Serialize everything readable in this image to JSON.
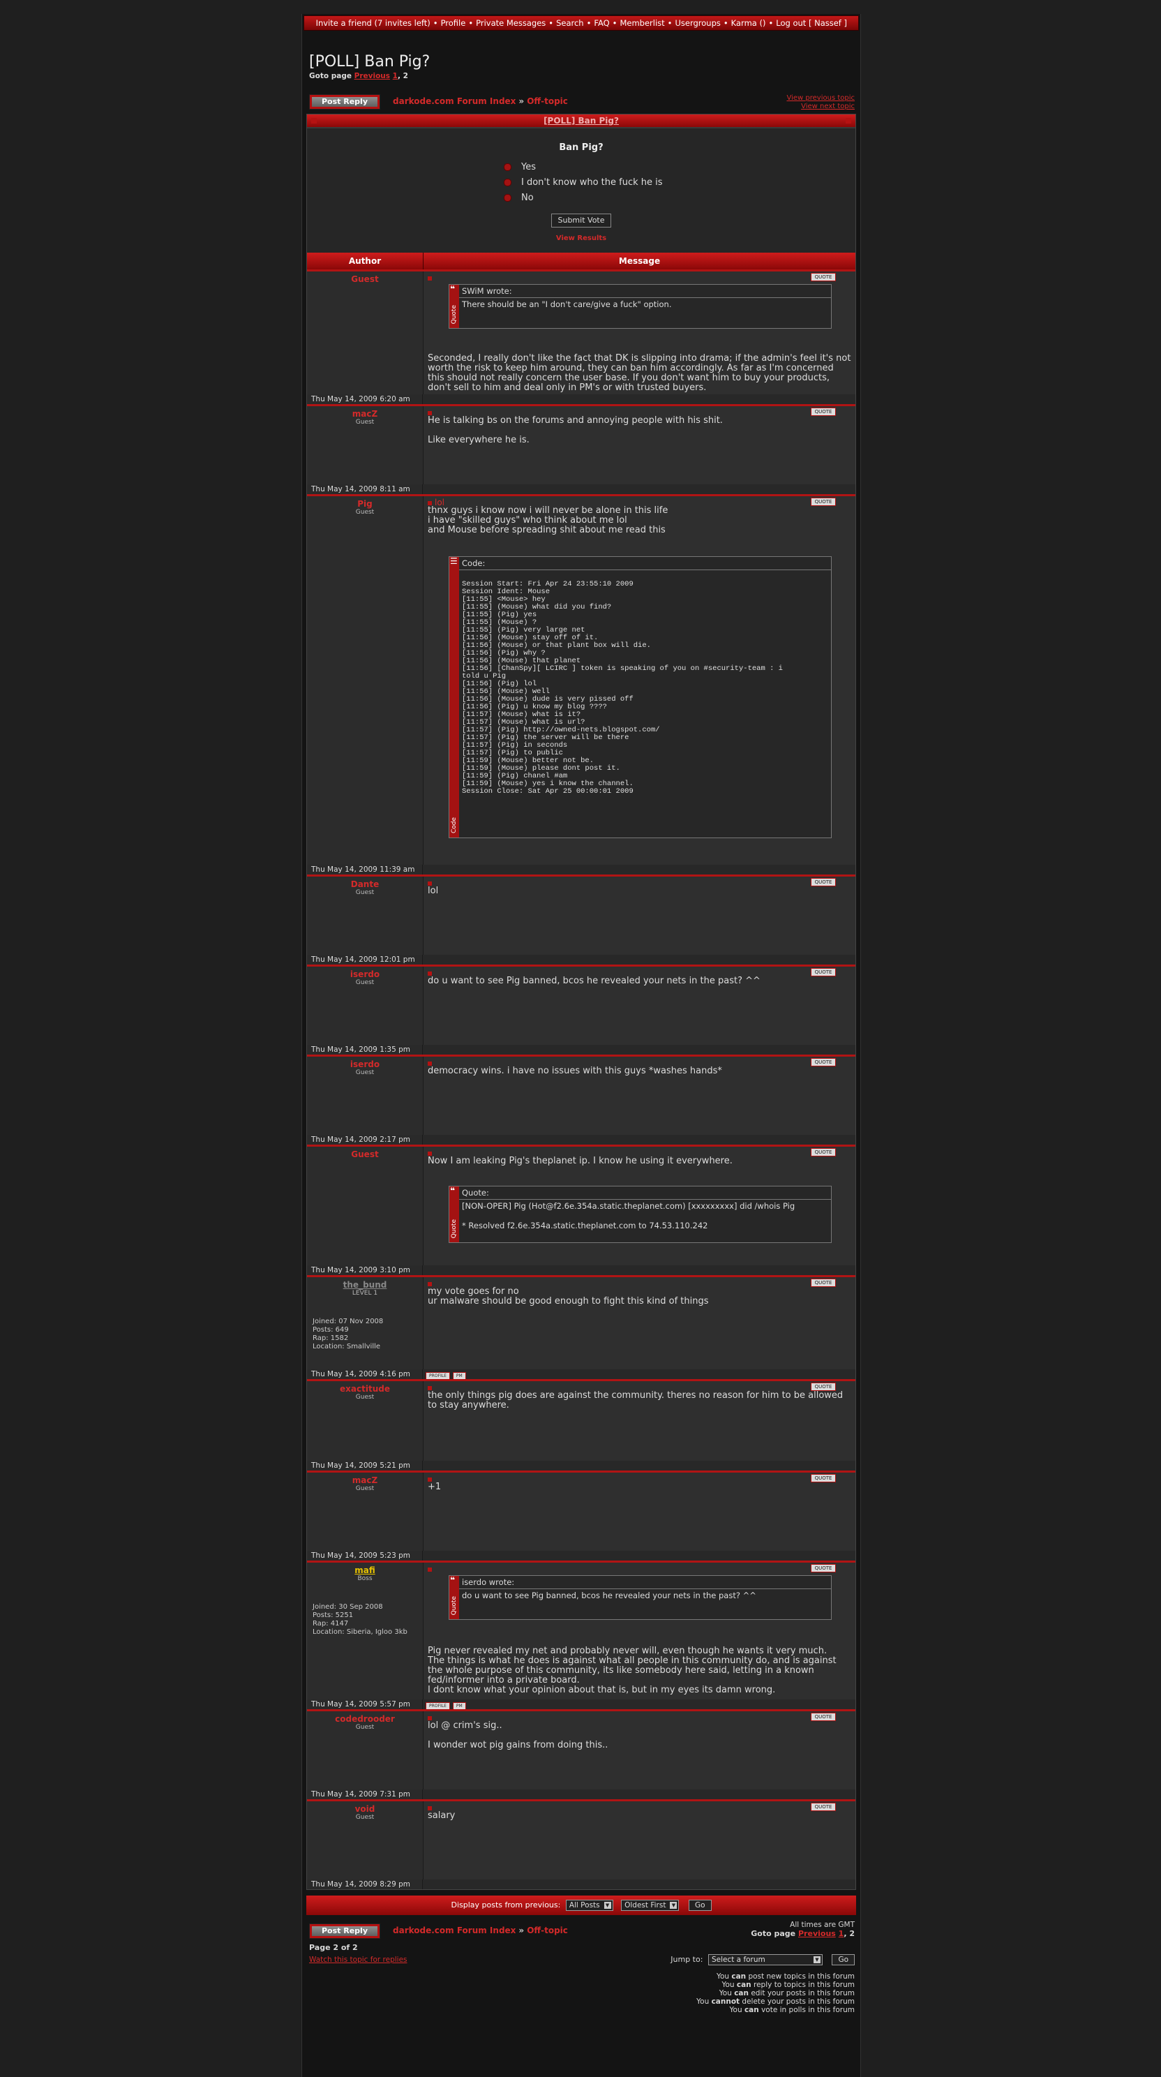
{
  "nav": {
    "items": [
      "Invite a friend (7 invites left)",
      "Profile",
      "Private Messages",
      "Search",
      "FAQ",
      "Memberlist",
      "Usergroups",
      "Karma ()",
      "Log out [ Nassef ]"
    ],
    "sep": "•"
  },
  "topic": {
    "title": "[POLL] Ban Pig?",
    "goto_label": "Goto page",
    "prev_label": "Previous",
    "page_one": "1",
    "page_two": ", 2"
  },
  "crumbs": {
    "reply_label": "Post Reply",
    "index": "darkode.com Forum Index",
    "sep": "»",
    "forum": "Off-topic",
    "view_prev": "View previous topic",
    "view_next": "View next topic"
  },
  "poll": {
    "bar_title": "[POLL] Ban Pig?",
    "question": "Ban Pig?",
    "options": [
      "Yes",
      "I don't know who the fuck he is",
      "No"
    ],
    "submit": "Submit Vote",
    "view_results": "View Results"
  },
  "table_head": {
    "author": "Author",
    "message": "Message"
  },
  "quote_btn": "QUOTE",
  "quote_side": "Quote",
  "code_side": "Code",
  "profile_btn": "PROFILE",
  "pm_btn": "PM",
  "posts": [
    {
      "author": "Guest",
      "rank": "",
      "date": "Thu May 14, 2009 6:20 am",
      "quote_head": "SWiM wrote:",
      "quote_body": "There should be an \"I don't care/give a fuck\" option.",
      "lines": [
        "Seconded, I really don't like the fact that DK is slipping into drama; if the admin's feel it's not worth the risk to keep him around, they can ban him accordingly. As far as I'm concerned this should not really concern the user base. If you don't want him to buy your products, don't sell to him and deal only in PM's or with trusted buyers."
      ]
    },
    {
      "author": "macZ",
      "rank": "Guest",
      "date": "Thu May 14, 2009 8:11 am",
      "lines": [
        "He is talking bs on the forums and annoying people with his shit.",
        "",
        "Like everywhere he is."
      ]
    },
    {
      "author": "Pig",
      "rank": "Guest",
      "date": "Thu May 14, 2009 11:39 am",
      "subject": "lol",
      "lines": [
        "thnx guys i know now i will never be alone in this life",
        "i have \"skilled guys\" who think about me lol",
        "and Mouse before spreading shit about me read this"
      ],
      "code_head": "Code:",
      "code": "\nSession Start: Fri Apr 24 23:55:10 2009\nSession Ident: Mouse\n[11:55] <Mouse> hey\n[11:55] (Mouse) what did you find?\n[11:55] (Pig) yes\n[11:55] (Mouse) ?\n[11:55] (Pig) very large net\n[11:56] (Mouse) stay off of it.\n[11:56] (Mouse) or that plant box will die.\n[11:56] (Pig) why ?\n[11:56] (Mouse) that planet\n[11:56] [ChanSpy][ LCIRC ] token is speaking of you on #security-team : i\ntold u Pig\n[11:56] (Pig) lol\n[11:56] (Mouse) well\n[11:56] (Mouse) dude is very pissed off\n[11:56] (Pig) u know my blog ????\n[11:57] (Mouse) what is it?\n[11:57] (Mouse) what is url?\n[11:57] (Pig) http://owned-nets.blogspot.com/\n[11:57] (Pig) the server will be there\n[11:57] (Pig) in seconds\n[11:57] (Pig) to public\n[11:59] (Mouse) better not be.\n[11:59] (Mouse) please dont post it.\n[11:59] (Pig) chanel #am\n[11:59] (Mouse) yes i know the channel.\nSession Close: Sat Apr 25 00:00:01 2009"
    },
    {
      "author": "Dante",
      "rank": "Guest",
      "date": "Thu May 14, 2009 12:01 pm",
      "lines": [
        "lol"
      ]
    },
    {
      "author": "iserdo",
      "rank": "Guest",
      "date": "Thu May 14, 2009 1:35 pm",
      "lines": [
        "do u want to see Pig banned, bcos he revealed your nets in the past? ^^"
      ]
    },
    {
      "author": "iserdo",
      "rank": "Guest",
      "date": "Thu May 14, 2009 2:17 pm",
      "lines": [
        "democracy wins. i have no issues with this guys *washes hands*"
      ]
    },
    {
      "author": "Guest",
      "rank": "",
      "date": "Thu May 14, 2009 3:10 pm",
      "lines": [
        "Now I am leaking Pig's theplanet ip. I know he using it everywhere."
      ],
      "quote2_head": "Quote:",
      "quote2_body": [
        "[NON-OPER] Pig (Hot@f2.6e.354a.static.theplanet.com) [xxxxxxxxx] did /whois Pig",
        "",
        "* Resolved f2.6e.354a.static.theplanet.com to 74.53.110.242"
      ]
    },
    {
      "author": "the_bund",
      "rank": "LEVEL 1",
      "date": "Thu May 14, 2009 4:16 pm",
      "details": [
        "Joined: 07 Nov 2008",
        "Posts: 649",
        "Rap: 1582",
        "Location: Smallville"
      ],
      "lines": [
        "my vote goes for no",
        "ur malware should be good enough to fight this kind of things"
      ]
    },
    {
      "author": "exactitude",
      "rank": "Guest",
      "date": "Thu May 14, 2009 5:21 pm",
      "lines": [
        "the only things pig does are against the community. theres no reason for him to be allowed to stay anywhere."
      ]
    },
    {
      "author": "macZ",
      "rank": "Guest",
      "date": "Thu May 14, 2009 5:23 pm",
      "lines": [
        "+1"
      ]
    },
    {
      "author": "mafi",
      "rank": "Boss",
      "date": "Thu May 14, 2009 5:57 pm",
      "details": [
        "Joined: 30 Sep 2008",
        "Posts: 5251",
        "Rap: 4147",
        "Location: Siberia, Igloo 3kb"
      ],
      "quote_head": "iserdo wrote:",
      "quote_body": "do u want to see Pig banned, bcos he revealed your nets in the past? ^^",
      "lines": [
        "Pig never revealed my net and probably never will, even though he wants it very much.",
        "The things is what he does is against what all people in this community do, and is against the whole purpose of this community, its like somebody here said, letting in a known fed/informer into a private board.",
        "I dont know what your opinion about that is, but in my eyes its damn wrong."
      ]
    },
    {
      "author": "codedrooder",
      "rank": "Guest",
      "date": "Thu May 14, 2009 7:31 pm",
      "lines": [
        "lol @ crim's sig..",
        "",
        "I wonder wot pig gains from doing this.."
      ]
    },
    {
      "author": "void",
      "rank": "Guest",
      "date": "Thu May 14, 2009 8:29 pm",
      "lines": [
        "salary"
      ]
    }
  ],
  "display": {
    "label": "Display posts from previous:",
    "all_posts": "All Posts",
    "oldest": "Oldest First",
    "go": "Go"
  },
  "footer": {
    "reply_label": "Post Reply",
    "all_times": "All times are GMT",
    "page_of": "Page 2 of 2",
    "watch": "Watch this topic for replies",
    "jump_label": "Jump to:",
    "jump_select": "Select a forum",
    "jump_go": "Go",
    "perms": [
      [
        "You ",
        "can",
        " post new topics in this forum"
      ],
      [
        "You ",
        "can",
        " reply to topics in this forum"
      ],
      [
        "You ",
        "can",
        " edit your posts in this forum"
      ],
      [
        "You ",
        "cannot",
        " delete your posts in this forum"
      ],
      [
        "You ",
        "can",
        " vote in polls in this forum"
      ]
    ]
  }
}
